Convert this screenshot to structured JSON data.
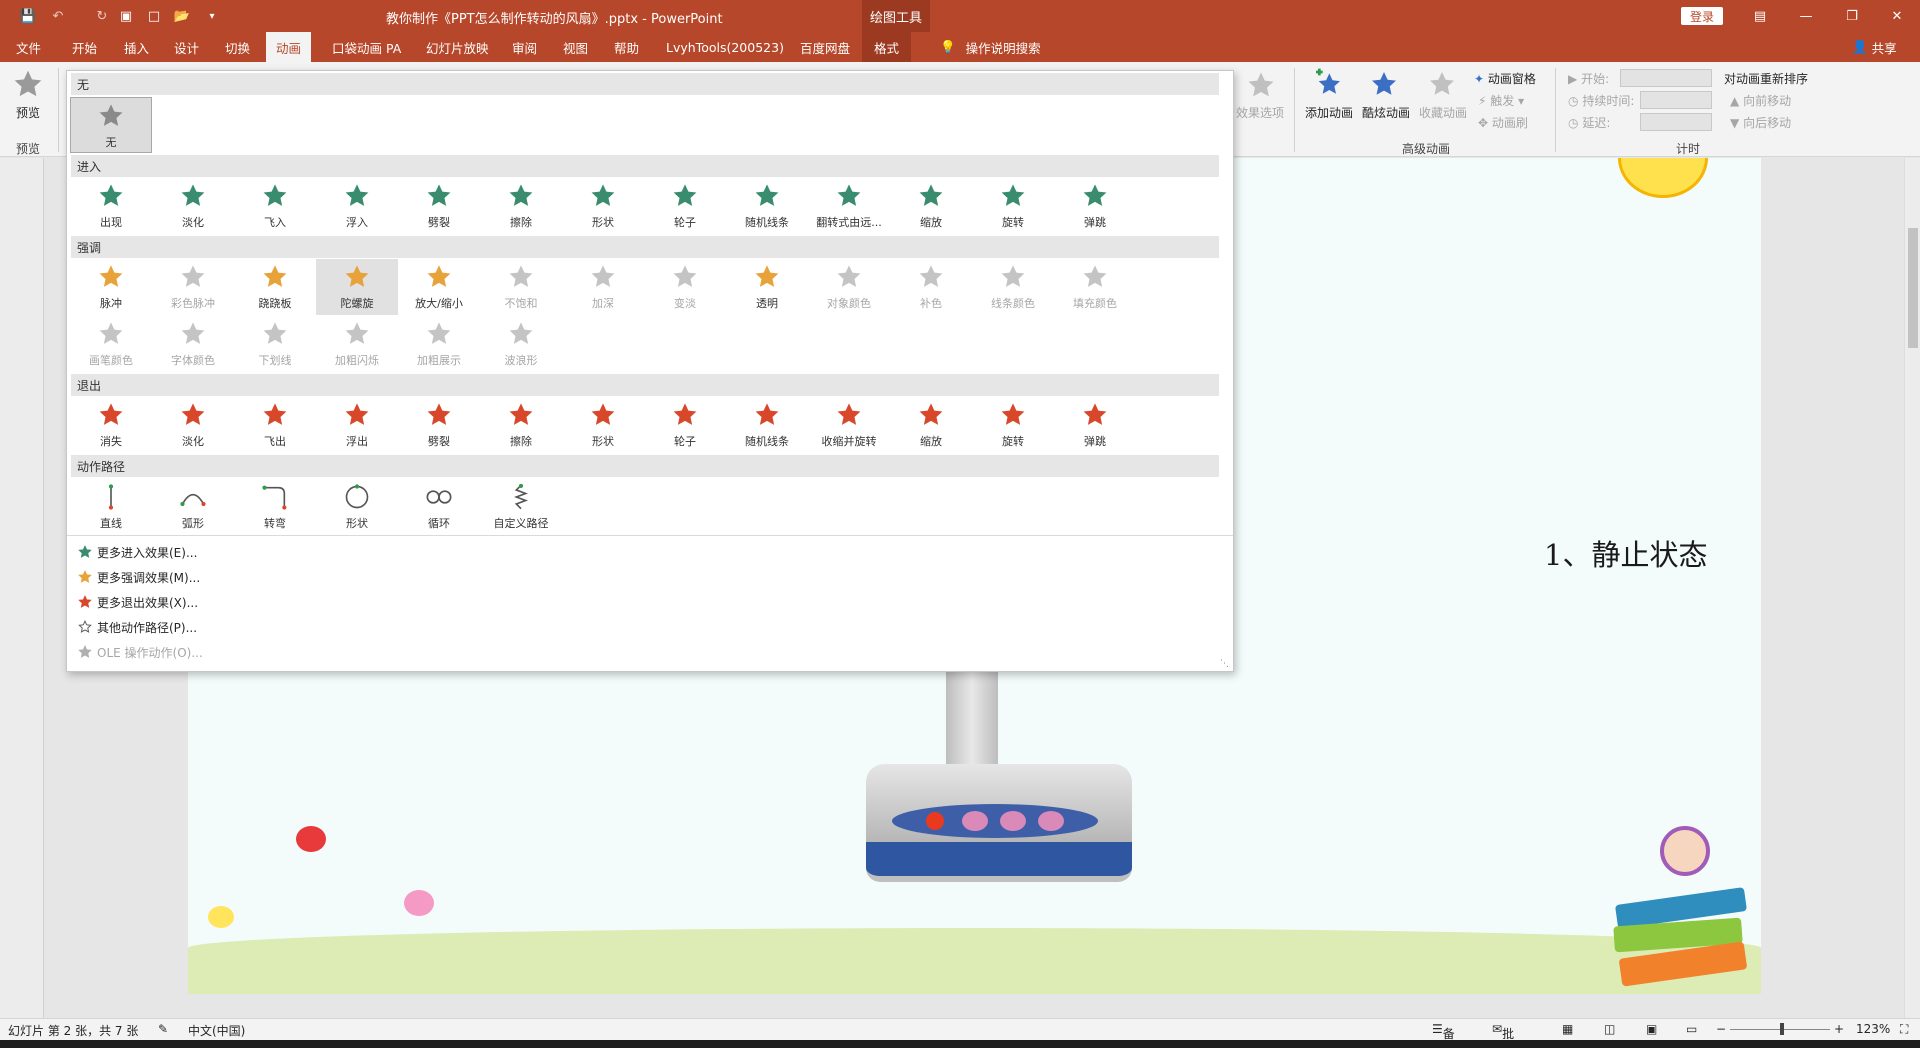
{
  "window": {
    "title": "教你制作《PPT怎么制作转动的风扇》.pptx  -  PowerPoint",
    "contextual_group": "绘图工具",
    "login": "登录"
  },
  "tabs": [
    {
      "label": "文件"
    },
    {
      "label": "开始"
    },
    {
      "label": "插入"
    },
    {
      "label": "设计"
    },
    {
      "label": "切换"
    },
    {
      "label": "动画"
    },
    {
      "label": "口袋动画 PA"
    },
    {
      "label": "幻灯片放映"
    },
    {
      "label": "审阅"
    },
    {
      "label": "视图"
    },
    {
      "label": "帮助"
    },
    {
      "label": "LvyhTools(200523)"
    },
    {
      "label": "百度网盘"
    },
    {
      "label": "格式"
    }
  ],
  "tell_me": "操作说明搜索",
  "share": "共享",
  "ribbon": {
    "preview_label": "预览",
    "preview_group": "预览",
    "effect_options": "效果选项",
    "add_animation": "添加动画",
    "painter_animation": "酷炫动画",
    "favorite_animation": "收藏动画",
    "animation_pane": "动画窗格",
    "trigger": "触发",
    "animation_brush": "动画刷",
    "advanced_group": "高级动画",
    "start_label": "开始:",
    "duration_label": "持续时间:",
    "delay_label": "延迟:",
    "reorder_title": "对动画重新排序",
    "move_earlier": "向前移动",
    "move_later": "向后移动",
    "timing_group": "计时"
  },
  "gallery": {
    "none_header": "无",
    "none_item": "无",
    "entrance_header": "进入",
    "entrance": [
      "出现",
      "淡化",
      "飞入",
      "浮入",
      "劈裂",
      "擦除",
      "形状",
      "轮子",
      "随机线条",
      "翻转式由远...",
      "缩放",
      "旋转",
      "弹跳"
    ],
    "emphasis_header": "强调",
    "emphasis": [
      "脉冲",
      "彩色脉冲",
      "跷跷板",
      "陀螺旋",
      "放大/缩小",
      "不饱和",
      "加深",
      "变淡",
      "透明",
      "对象颜色",
      "补色",
      "线条颜色",
      "填充颜色",
      "画笔颜色",
      "字体颜色",
      "下划线",
      "加粗闪烁",
      "加粗展示",
      "波浪形"
    ],
    "emphasis_disabled": [
      1,
      5,
      6,
      7,
      9,
      10,
      11,
      12,
      13,
      14,
      15,
      16,
      17,
      18
    ],
    "exit_header": "退出",
    "exit": [
      "消失",
      "淡化",
      "飞出",
      "浮出",
      "劈裂",
      "擦除",
      "形状",
      "轮子",
      "随机线条",
      "收缩并旋转",
      "缩放",
      "旋转",
      "弹跳"
    ],
    "path_header": "动作路径",
    "paths": [
      "直线",
      "弧形",
      "转弯",
      "形状",
      "循环",
      "自定义路径"
    ],
    "more": [
      {
        "label": "更多进入效果(E)...",
        "color": "#3a8c6e"
      },
      {
        "label": "更多强调效果(M)...",
        "color": "#e7a23a"
      },
      {
        "label": "更多退出效果(X)...",
        "color": "#d9472b"
      },
      {
        "label": "其他动作路径(P)...",
        "color": "#555555"
      },
      {
        "label": "OLE 操作动作(O)...",
        "color": "#b0b0b0"
      }
    ],
    "colors": {
      "entrance": "#3a8c6e",
      "emphasis": "#e7a23a",
      "exit": "#d9472b",
      "disabled": "#c4c4c4"
    }
  },
  "slide": {
    "text": "1、静止状态"
  },
  "statusbar": {
    "slide_info": "幻灯片 第 2 张，共 7 张",
    "language": "中文(中国)",
    "notes": "备注",
    "comments": "批注",
    "zoom": "123%"
  }
}
